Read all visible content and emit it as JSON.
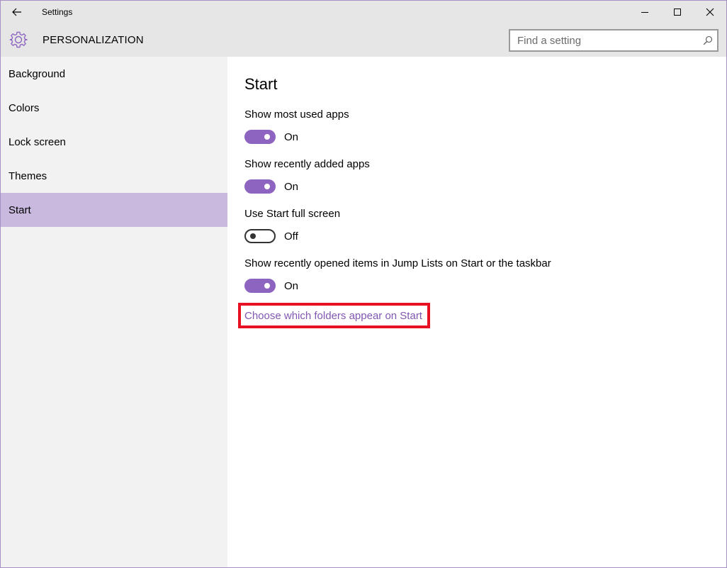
{
  "window": {
    "title": "Settings",
    "accent_color": "#8d64c0",
    "selected_nav_color": "#c9b9de",
    "highlight_box_color": "#e81123"
  },
  "header": {
    "title": "PERSONALIZATION",
    "icon": "gear-icon",
    "search": {
      "placeholder": "Find a setting",
      "value": ""
    }
  },
  "sidebar": {
    "items": [
      {
        "label": "Background",
        "selected": false
      },
      {
        "label": "Colors",
        "selected": false
      },
      {
        "label": "Lock screen",
        "selected": false
      },
      {
        "label": "Themes",
        "selected": false
      },
      {
        "label": "Start",
        "selected": true
      }
    ]
  },
  "main": {
    "title": "Start",
    "settings": [
      {
        "label": "Show most used apps",
        "state": "On"
      },
      {
        "label": "Show recently added apps",
        "state": "On"
      },
      {
        "label": "Use Start full screen",
        "state": "Off"
      },
      {
        "label": "Show recently opened items in Jump Lists on Start or the taskbar",
        "state": "On"
      }
    ],
    "link": "Choose which folders appear on Start"
  }
}
